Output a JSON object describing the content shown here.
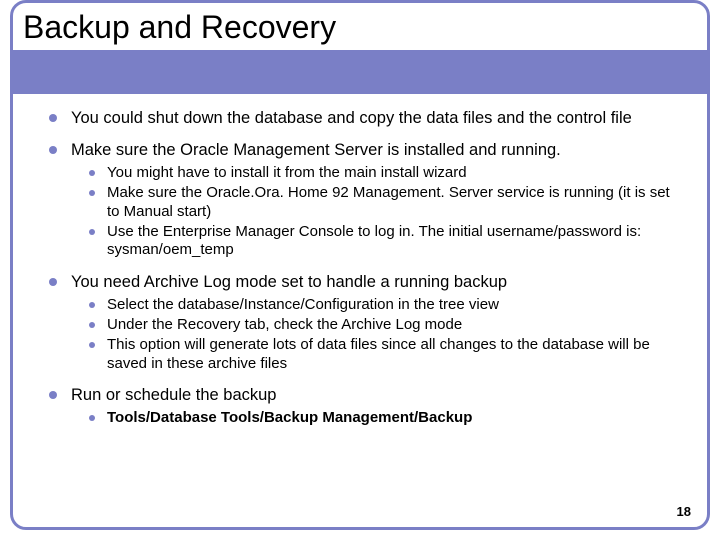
{
  "slide": {
    "title": "Backup and Recovery",
    "page_number": "18",
    "bullets": {
      "b1": "You could shut down the database and copy the data files and the control file",
      "b2": "Make sure the Oracle Management Server is installed and running.",
      "b2_subs": {
        "s1": "You might have to install it from the main install wizard",
        "s2": "Make sure the Oracle.Ora. Home 92 Management. Server service is running (it is set to Manual start)",
        "s3": "Use the Enterprise Manager Console to log in. The initial username/password is: sysman/oem_temp"
      },
      "b3": "You need Archive Log mode set to handle a running backup",
      "b3_subs": {
        "s1": "Select the database/Instance/Configuration in the tree view",
        "s2": "Under the Recovery tab, check the Archive Log mode",
        "s3": "This option will generate lots of data files since all changes to the database will be saved in these archive files"
      },
      "b4": "Run or schedule the backup",
      "b4_subs": {
        "s1": "Tools/Database Tools/Backup Management/Backup"
      }
    }
  }
}
